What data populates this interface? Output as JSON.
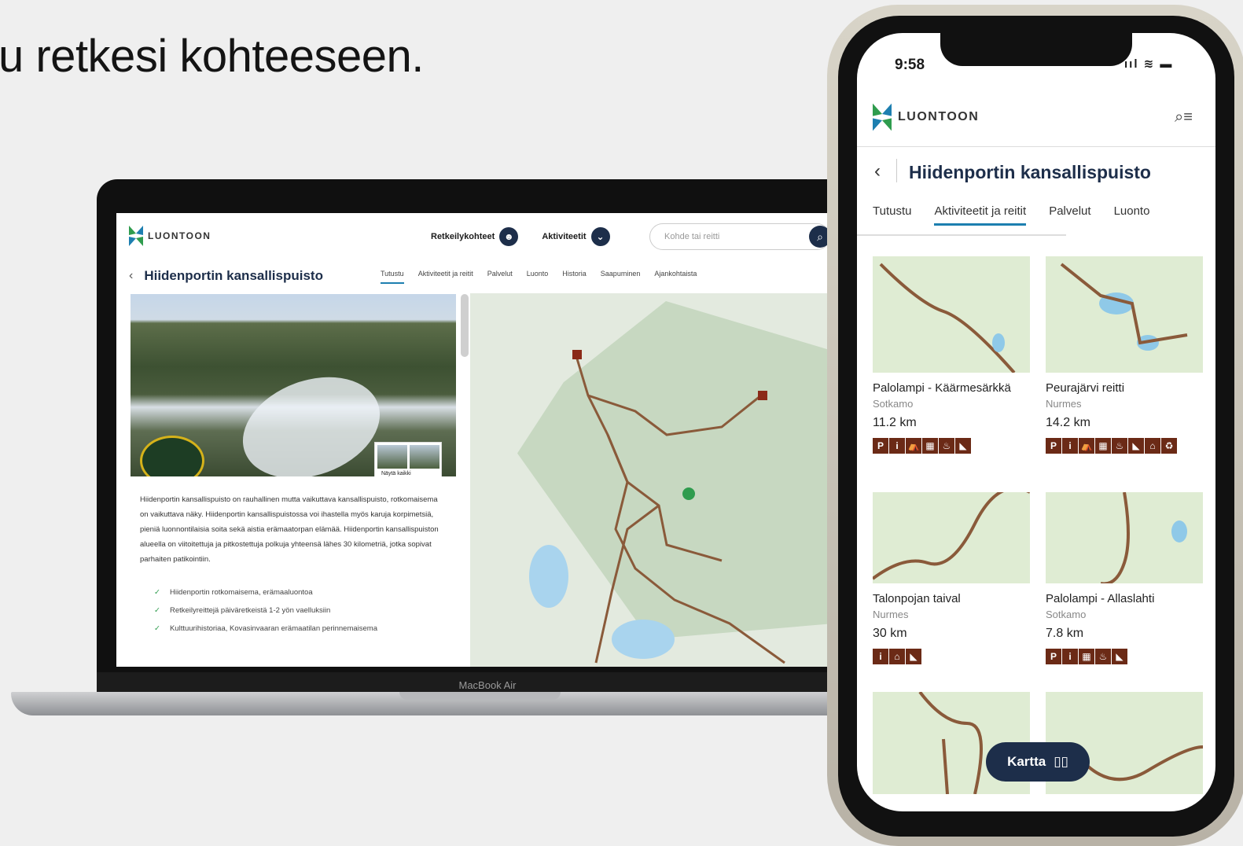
{
  "headline": "u retkesi kohteeseen.",
  "laptop": {
    "brand_label": "MacBook Air",
    "logo_text": "LUONTOON",
    "nav": [
      {
        "label": "Retkeilykohteet",
        "icon": "hiker-icon"
      },
      {
        "label": "Aktiviteetit",
        "icon": "chevron-down-icon"
      }
    ],
    "search_placeholder": "Kohde tai reitti",
    "page_title": "Hiidenportin kansallispuisto",
    "tabs": [
      "Tutustu",
      "Aktiviteetit ja reitit",
      "Palvelut",
      "Luonto",
      "Historia",
      "Saapuminen",
      "Ajankohtaista"
    ],
    "active_tab": 0,
    "photo_gallery_label": "Näytä kaikki",
    "description": "Hiidenportin kansallispuisto on rauhallinen mutta vaikuttava kansallispuisto, rotkomaisema on vaikuttava näky. Hiidenportin kansallispuistossa voi ihastella myös karuja korpimetsiä, pieniä luonnontilaisia soita sekä aistia erämaatorpan elämää. Hiidenportin kansallispuiston alueella on viitoitettuja ja pitkostettuja polkuja yhteensä lähes 30 kilometriä, jotka sopivat parhaiten patikointiin.",
    "highlights": [
      "Hiidenportin rotkomaisema, erämaaluontoa",
      "Retkeilyreittejä päiväretkeistä 1-2 yön vaelluksiin",
      "Kulttuurihistoriaa, Kovasinvaaran erämaatilan perinnemaisema"
    ]
  },
  "phone": {
    "time": "9:58",
    "status": "ııl ≋ ▬",
    "logo_text": "LUONTOON",
    "page_title": "Hiidenportin kansallispuisto",
    "tabs": [
      "Tutustu",
      "Aktiviteetit ja reitit",
      "Palvelut",
      "Luonto"
    ],
    "active_tab": 1,
    "map_button": "Kartta",
    "routes": [
      {
        "name": "Palolampi - Käärmesärkkä",
        "location": "Sotkamo",
        "distance": "11.2 km",
        "icons": [
          "P",
          "i",
          "⛺",
          "▦",
          "♨",
          "◣"
        ]
      },
      {
        "name": "Peurajärvi reitti",
        "location": "Nurmes",
        "distance": "14.2 km",
        "icons": [
          "P",
          "i",
          "⛺",
          "▦",
          "♨",
          "◣",
          "⌂",
          "♻"
        ]
      },
      {
        "name": "Talonpojan taival",
        "location": "Nurmes",
        "distance": "30 km",
        "icons": [
          "i",
          "⌂",
          "◣"
        ]
      },
      {
        "name": "Palolampi - Allaslahti",
        "location": "Sotkamo",
        "distance": "7.8 km",
        "icons": [
          "P",
          "i",
          "▦",
          "♨",
          "◣"
        ]
      }
    ]
  }
}
